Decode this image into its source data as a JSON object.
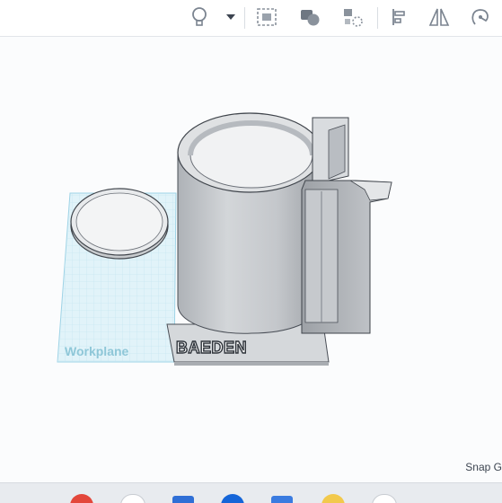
{
  "toolbar": {
    "buttons": [
      {
        "name": "show-all-toggle-icon",
        "title": "Toggle light"
      },
      {
        "name": "dropdown-arrow-icon",
        "title": "More"
      },
      {
        "name": "workplane-icon",
        "title": "Workplane"
      },
      {
        "name": "group-icon",
        "title": "Group"
      },
      {
        "name": "ungroup-icon",
        "title": "Ungroup"
      },
      {
        "name": "align-icon",
        "title": "Align"
      },
      {
        "name": "mirror-icon",
        "title": "Mirror"
      },
      {
        "name": "cruise-icon",
        "title": "Cruise"
      }
    ]
  },
  "viewport": {
    "workplane_label": "Workplane",
    "engraved_text": "BAEDEN"
  },
  "status": {
    "snap_label": "Snap G"
  },
  "colors": {
    "accent": "#0a84c6",
    "workplane_fill": "#dff1f8",
    "workplane_grid": "#a9d8ea",
    "model": "#cfd2d6",
    "model_edge": "#4a4f57"
  },
  "taskbar": {
    "apps": [
      "chrome-icon",
      "app-icon",
      "mail-icon",
      "edge-icon",
      "store-icon",
      "folder-icon",
      "settings-icon"
    ]
  }
}
